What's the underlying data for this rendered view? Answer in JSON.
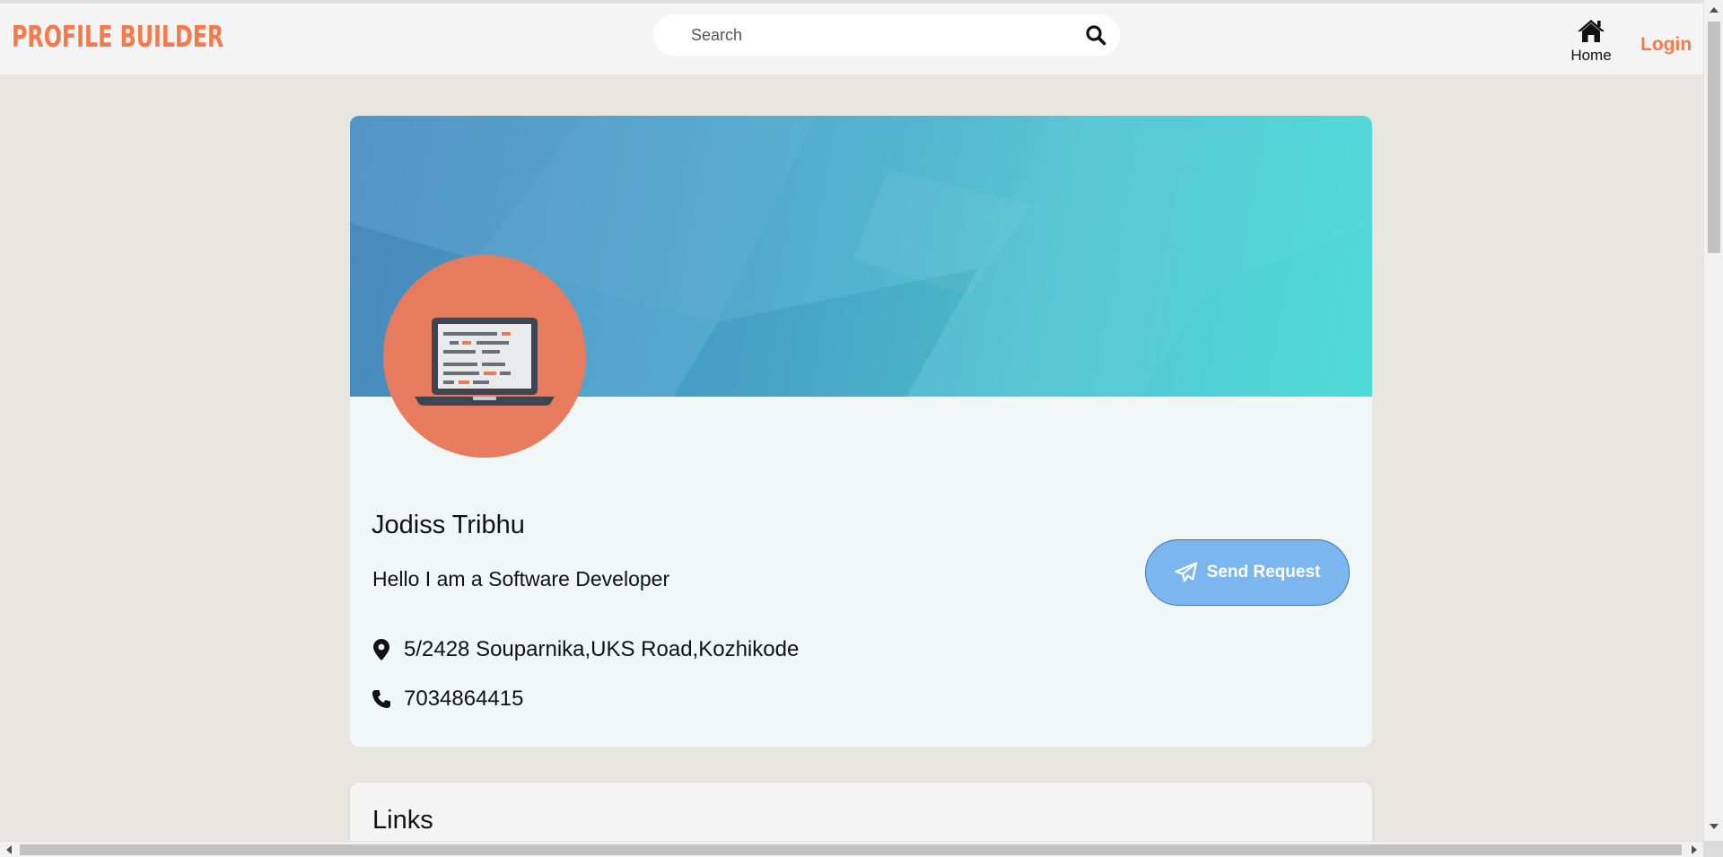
{
  "navbar": {
    "brand": "PROFILE BUILDER",
    "search_placeholder": "Search",
    "home_label": "Home",
    "login_label": "Login"
  },
  "profile": {
    "name": "Jodiss Tribhu",
    "bio": "Hello I am a Software Developer",
    "address": "5/2428 Souparnika,UKS Road,Kozhikode",
    "phone": "7034864415",
    "send_request_label": "Send Request"
  },
  "links": {
    "title": "Links"
  },
  "colors": {
    "brand": "#f47a4c",
    "avatar_bg": "#e67c5d",
    "send_button": "#7bb7ee",
    "page_bg": "#e7e6e1",
    "card_bg": "#f1f7f7"
  },
  "icons": {
    "search": "search-icon",
    "home": "home-icon",
    "location": "map-marker-icon",
    "phone": "phone-icon",
    "send": "paper-plane-icon",
    "avatar": "laptop-icon"
  }
}
